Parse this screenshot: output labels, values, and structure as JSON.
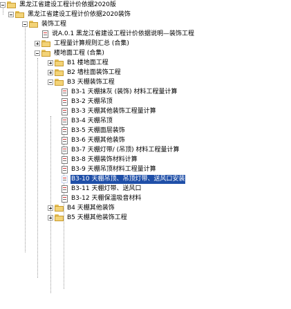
{
  "tree": {
    "nodes": [
      {
        "label": "黑龙江省建设工程计价依据2020版",
        "kind": "folder",
        "state": "expanded"
      },
      {
        "label": "黑龙江省建设工程计价依据2020装饰",
        "kind": "folder",
        "state": "expanded"
      },
      {
        "label": "装饰工程",
        "kind": "folder",
        "state": "expanded"
      },
      {
        "label": "说A.0.1 黑龙江省建设工程计价依据说明—装饰工程",
        "kind": "doc"
      },
      {
        "label": "工程量计算规则汇总 (合集)",
        "kind": "folder",
        "state": "collapsed"
      },
      {
        "label": "楼地面工程 (合集)",
        "kind": "folder",
        "state": "expanded"
      },
      {
        "label": "B1 楼地面工程",
        "kind": "folder",
        "state": "collapsed"
      },
      {
        "label": "B2 墙柱面装饰工程",
        "kind": "folder",
        "state": "collapsed"
      },
      {
        "label": "B3 天棚装饰工程",
        "kind": "folder",
        "state": "expanded"
      },
      {
        "label": "B3-1 天棚抹灰 (装饰) 材料工程量计算",
        "kind": "doc"
      },
      {
        "label": "B3-2 天棚吊顶",
        "kind": "doc"
      },
      {
        "label": "B3-3 天棚其他装饰工程量计算",
        "kind": "doc"
      },
      {
        "label": "B3-4 天棚吊顶",
        "kind": "doc"
      },
      {
        "label": "B3-5 天棚面层装饰",
        "kind": "doc"
      },
      {
        "label": "B3-6 天棚其他装饰",
        "kind": "doc"
      },
      {
        "label": "B3-7 天棚灯带/ (吊顶) 材料工程量计算",
        "kind": "doc"
      },
      {
        "label": "B3-8 天棚装饰材料计算",
        "kind": "doc"
      },
      {
        "label": "B3-9 天棚吊顶材料工程量计算",
        "kind": "doc"
      },
      {
        "label": "B3-10 天棚吊顶、吊顶灯带、送风口安装",
        "kind": "doc",
        "selected": true
      },
      {
        "label": "B3-11 天棚灯带、送风口",
        "kind": "doc"
      },
      {
        "label": "B3-12 天棚保温吸音材料",
        "kind": "doc"
      },
      {
        "label": "B4 天棚其他装饰",
        "kind": "folder",
        "state": "collapsed"
      },
      {
        "label": "B5 天棚其他装饰工程",
        "kind": "folder",
        "state": "collapsed"
      }
    ]
  }
}
